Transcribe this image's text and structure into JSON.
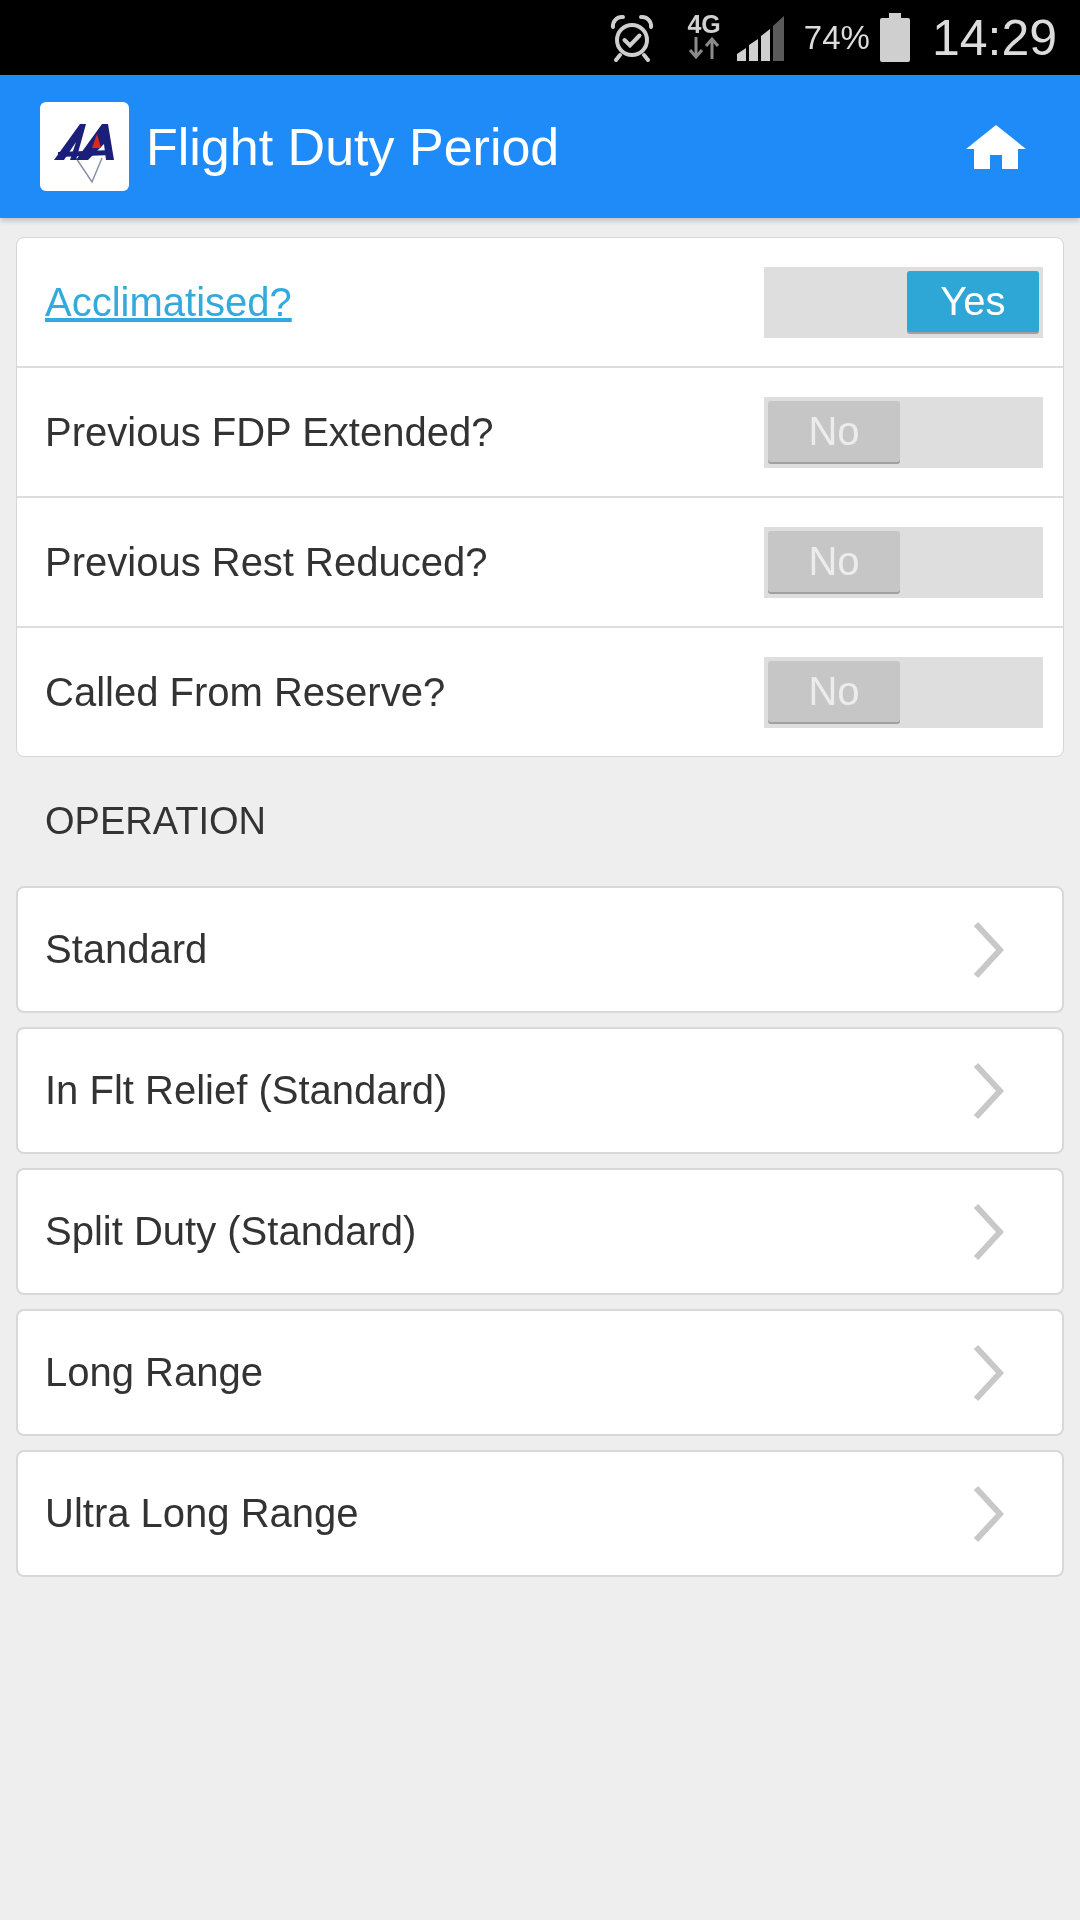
{
  "status_bar": {
    "network": "4G",
    "battery": "74%",
    "time": "14:29"
  },
  "app_bar": {
    "title": "Flight Duty Period"
  },
  "toggles": [
    {
      "label": "Acclimatised?",
      "kind": "link",
      "on": true,
      "value": "Yes"
    },
    {
      "label": "Previous FDP Extended?",
      "kind": "plain",
      "on": false,
      "value": "No"
    },
    {
      "label": "Previous Rest Reduced?",
      "kind": "plain",
      "on": false,
      "value": "No"
    },
    {
      "label": "Called From Reserve?",
      "kind": "plain",
      "on": false,
      "value": "No"
    }
  ],
  "section_header": "OPERATION",
  "operations": [
    {
      "label": "Standard"
    },
    {
      "label": "In Flt Relief (Standard)"
    },
    {
      "label": "Split Duty (Standard)"
    },
    {
      "label": "Long Range"
    },
    {
      "label": "Ultra Long Range"
    }
  ]
}
